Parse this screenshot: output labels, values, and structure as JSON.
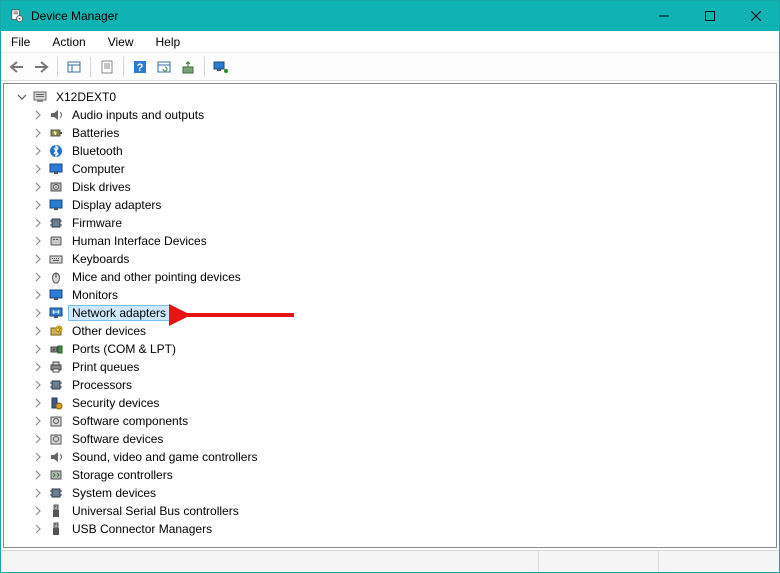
{
  "window": {
    "title": "Device Manager"
  },
  "menu": {
    "file": "File",
    "action": "Action",
    "view": "View",
    "help": "Help"
  },
  "toolbar": {
    "back": "Back",
    "forward": "Forward",
    "show_hidden": "Show hidden devices",
    "properties": "Properties",
    "help": "Help",
    "refresh": "Refresh",
    "update_driver": "Update driver",
    "remote": "Connect to remote"
  },
  "tree": {
    "root": {
      "label": "X12DEXT0",
      "expanded": true
    },
    "items": [
      {
        "label": "Audio inputs and outputs",
        "icon": "audio"
      },
      {
        "label": "Batteries",
        "icon": "battery"
      },
      {
        "label": "Bluetooth",
        "icon": "bluetooth"
      },
      {
        "label": "Computer",
        "icon": "monitor"
      },
      {
        "label": "Disk drives",
        "icon": "disk"
      },
      {
        "label": "Display adapters",
        "icon": "monitor"
      },
      {
        "label": "Firmware",
        "icon": "chip"
      },
      {
        "label": "Human Interface Devices",
        "icon": "hid"
      },
      {
        "label": "Keyboards",
        "icon": "keyboard"
      },
      {
        "label": "Mice and other pointing devices",
        "icon": "mouse"
      },
      {
        "label": "Monitors",
        "icon": "monitor"
      },
      {
        "label": "Network adapters",
        "icon": "network",
        "selected": true
      },
      {
        "label": "Other devices",
        "icon": "other"
      },
      {
        "label": "Ports (COM & LPT)",
        "icon": "port"
      },
      {
        "label": "Print queues",
        "icon": "printer"
      },
      {
        "label": "Processors",
        "icon": "chip"
      },
      {
        "label": "Security devices",
        "icon": "security"
      },
      {
        "label": "Software components",
        "icon": "software"
      },
      {
        "label": "Software devices",
        "icon": "software"
      },
      {
        "label": "Sound, video and game controllers",
        "icon": "audio"
      },
      {
        "label": "Storage controllers",
        "icon": "storage"
      },
      {
        "label": "System devices",
        "icon": "chip"
      },
      {
        "label": "Universal Serial Bus controllers",
        "icon": "usb"
      },
      {
        "label": "USB Connector Managers",
        "icon": "usb"
      }
    ]
  },
  "annotation": {
    "arrow_points_to": "Network adapters"
  }
}
